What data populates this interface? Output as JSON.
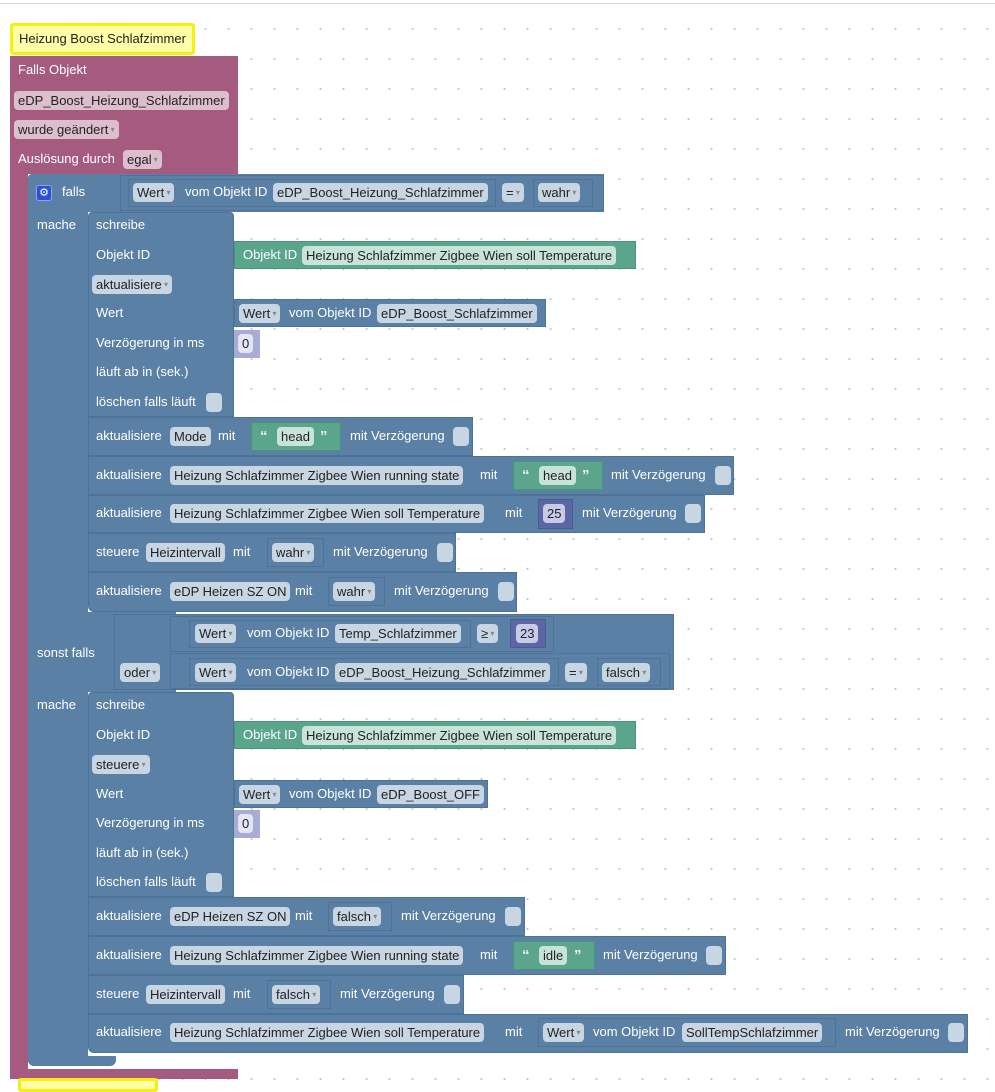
{
  "trigger": {
    "title": "Heizung Boost Schlafzimmer",
    "label": "Falls Objekt",
    "object_id": "eDP_Boost_Heizung_Schlafzimmer",
    "event": "wurde geändert",
    "ack_label": "Auslösung durch",
    "ack_value": "egal"
  },
  "if_block": {
    "falls_label": "falls",
    "mache_label": "mache",
    "sonst_falls_label": "sonst falls",
    "condition1": {
      "attr": "Wert",
      "from_label": "vom Objekt ID",
      "object": "eDP_Boost_Heizung_Schlafzimmer",
      "op": "=",
      "value": "wahr"
    },
    "write1": {
      "title": "schreibe",
      "object_label": "Objekt ID",
      "object_block_label": "Objekt ID",
      "object": "Heizung Schlafzimmer Zigbee Wien soll Temperature",
      "mode": "aktualisiere",
      "value_label": "Wert",
      "value_attr": "Wert",
      "value_from": "vom Objekt ID",
      "value_object": "eDP_Boost_Schlafzimmer",
      "delay_label": "Verzögerung in ms",
      "delay": "0",
      "expire_label": "läuft ab in (sek.)",
      "clear_label": "löschen falls läuft"
    },
    "actions1": [
      {
        "verb": "aktualisiere",
        "target": "Mode",
        "with": "mit",
        "value": "head",
        "kind": "text",
        "delay_label": "mit Verzögerung"
      },
      {
        "verb": "aktualisiere",
        "target": "Heizung Schlafzimmer Zigbee Wien running state",
        "with": "mit",
        "value": "head",
        "kind": "text",
        "delay_label": "mit Verzögerung"
      },
      {
        "verb": "aktualisiere",
        "target": "Heizung Schlafzimmer Zigbee Wien soll Temperature",
        "with": "mit",
        "value": "25",
        "kind": "number",
        "delay_label": "mit Verzögerung"
      },
      {
        "verb": "steuere",
        "target": "Heizintervall",
        "with": "mit",
        "value": "wahr",
        "kind": "bool",
        "delay_label": "mit Verzögerung"
      },
      {
        "verb": "aktualisiere",
        "target": "eDP Heizen SZ ON",
        "with": "mit",
        "value": "wahr",
        "kind": "bool",
        "delay_label": "mit Verzögerung"
      }
    ],
    "condition2": {
      "logic": "oder",
      "a": {
        "attr": "Wert",
        "from_label": "vom Objekt ID",
        "object": "Temp_Schlafzimmer",
        "op": "≥",
        "value": "23"
      },
      "b": {
        "attr": "Wert",
        "from_label": "vom Objekt ID",
        "object": "eDP_Boost_Heizung_Schlafzimmer",
        "op": "=",
        "value": "falsch"
      }
    },
    "write2": {
      "title": "schreibe",
      "object_label": "Objekt ID",
      "object_block_label": "Objekt ID",
      "object": "Heizung Schlafzimmer Zigbee Wien soll Temperature",
      "mode": "steuere",
      "value_label": "Wert",
      "value_attr": "Wert",
      "value_from": "vom Objekt ID",
      "value_object": "eDP_Boost_OFF",
      "delay_label": "Verzögerung in ms",
      "delay": "0",
      "expire_label": "läuft ab in (sek.)",
      "clear_label": "löschen falls läuft"
    },
    "actions2": [
      {
        "verb": "aktualisiere",
        "target": "eDP Heizen SZ ON",
        "with": "mit",
        "value": "falsch",
        "kind": "bool",
        "delay_label": "mit Verzögerung"
      },
      {
        "verb": "aktualisiere",
        "target": "Heizung Schlafzimmer Zigbee Wien running state",
        "with": "mit",
        "value": "idle",
        "kind": "text",
        "delay_label": "mit Verzögerung"
      },
      {
        "verb": "steuere",
        "target": "Heizintervall",
        "with": "mit",
        "value": "falsch",
        "kind": "bool",
        "delay_label": "mit Verzögerung"
      },
      {
        "verb": "aktualisiere",
        "target": "Heizung Schlafzimmer Zigbee Wien soll Temperature",
        "with": "mit",
        "value_attr": "Wert",
        "value_from": "vom Objekt ID",
        "value": "SollTempSchlafzimmer",
        "kind": "object",
        "delay_label": "mit Verzögerung"
      }
    ]
  },
  "colors": {
    "trigger": "#a55b80",
    "logic": "#5b80a5",
    "text": "#5ba58c",
    "number": "#5b67a5",
    "comment": "#fefea6"
  }
}
